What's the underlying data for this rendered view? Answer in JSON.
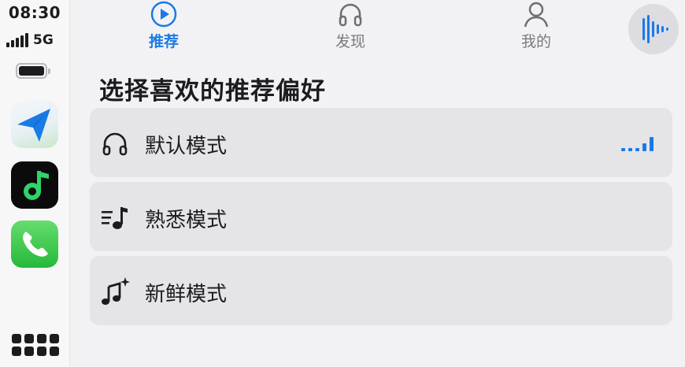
{
  "status_bar": {
    "time": "08:30",
    "network": "5G",
    "battery_level": 1.0
  },
  "dock": {
    "apps": [
      {
        "name": "Navigation",
        "icon": "paper-plane-icon"
      },
      {
        "name": "Music",
        "icon": "music-note-icon"
      },
      {
        "name": "Phone",
        "icon": "phone-handset-icon"
      }
    ],
    "app_grid_icon": "app-grid-icon"
  },
  "tabs": [
    {
      "label": "推荐",
      "icon": "play-circle-icon",
      "active": true
    },
    {
      "label": "发现",
      "icon": "headphones-icon",
      "active": false
    },
    {
      "label": "我的",
      "icon": "person-icon",
      "active": false
    }
  ],
  "now_playing_icon": "waveform-icon",
  "section": {
    "title": "选择喜欢的推荐偏好"
  },
  "modes": [
    {
      "label": "默认模式",
      "icon": "headphones-icon",
      "selected": true
    },
    {
      "label": "熟悉模式",
      "icon": "playlist-note-icon",
      "selected": false
    },
    {
      "label": "新鲜模式",
      "icon": "note-sparkle-icon",
      "selected": false
    }
  ],
  "colors": {
    "accent": "#1a7be6",
    "background": "#f2f2f4",
    "row_background": "#e5e5e8",
    "text": "#1c1c1e",
    "inactive_tab": "#7a7a7f"
  }
}
